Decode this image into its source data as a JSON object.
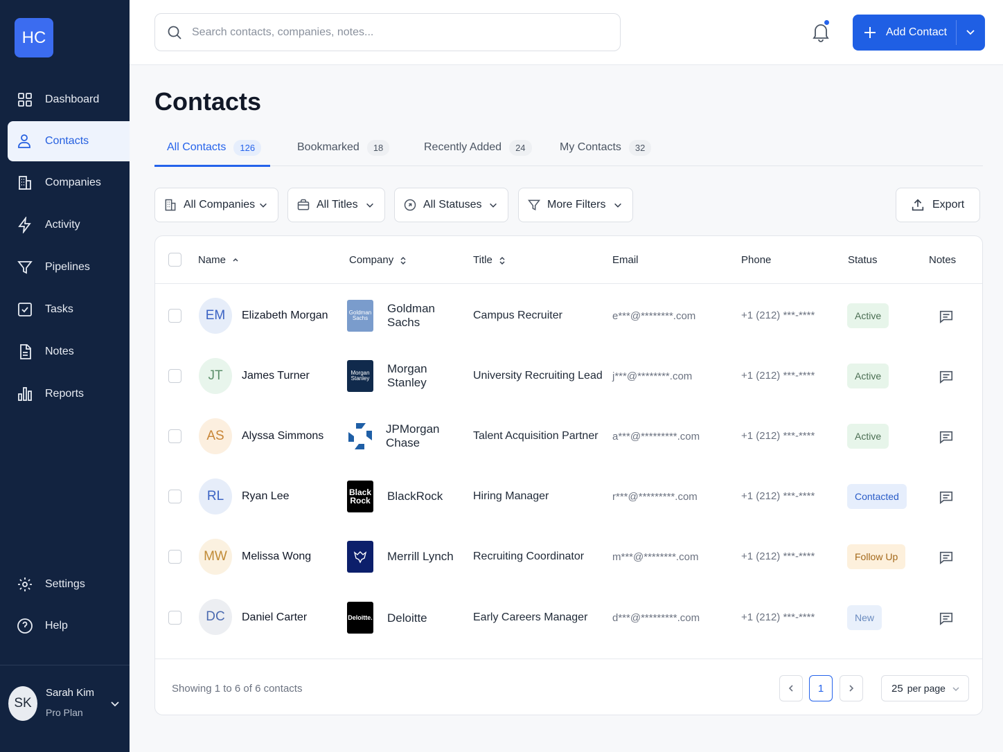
{
  "app": {
    "logo_text": "HC",
    "accent": "#2563eb",
    "sidebar_bg": "#122340"
  },
  "sidebar": {
    "items": [
      {
        "label": "Dashboard",
        "icon": "grid-icon"
      },
      {
        "label": "Contacts",
        "icon": "user-icon",
        "active": true
      },
      {
        "label": "Companies",
        "icon": "building-icon"
      },
      {
        "label": "Activity",
        "icon": "bolt-icon"
      },
      {
        "label": "Pipelines",
        "icon": "funnel-icon"
      },
      {
        "label": "Tasks",
        "icon": "checkbox-icon"
      },
      {
        "label": "Notes",
        "icon": "document-icon"
      },
      {
        "label": "Reports",
        "icon": "bar-chart-icon"
      }
    ],
    "bottom": [
      {
        "label": "Settings",
        "icon": "gear-icon"
      },
      {
        "label": "Help",
        "icon": "help-circle-icon"
      }
    ],
    "user": {
      "initials": "SK",
      "name": "Sarah Kim",
      "plan": "Pro Plan"
    }
  },
  "header": {
    "search_placeholder": "Search contacts, companies, notes...",
    "add_button": "Add Contact"
  },
  "page": {
    "title": "Contacts",
    "tabs": [
      {
        "label": "All Contacts",
        "count": "126",
        "active": true
      },
      {
        "label": "Bookmarked",
        "count": "18"
      },
      {
        "label": "Recently Added",
        "count": "24"
      },
      {
        "label": "My Contacts",
        "count": "32"
      }
    ],
    "filters": [
      {
        "label": "All Companies",
        "icon": "building-icon"
      },
      {
        "label": "All Titles",
        "icon": "briefcase-icon"
      },
      {
        "label": "All Statuses",
        "icon": "circle-status-icon"
      },
      {
        "label": "More Filters",
        "icon": "funnel-icon"
      }
    ],
    "export_label": "Export"
  },
  "table": {
    "columns": [
      "Name",
      "Company",
      "Title",
      "Email",
      "Phone",
      "Status",
      "Notes"
    ],
    "rows": [
      {
        "initials": "EM",
        "name": "Elizabeth Morgan",
        "company": "Goldman Sachs",
        "logo_text": "Goldman Sachs",
        "title": "Campus Recruiter",
        "email": "e***@********.com",
        "phone": "+1 (212) ***-****",
        "status": "Active"
      },
      {
        "initials": "JT",
        "name": "James Turner",
        "company": "Morgan Stanley",
        "logo_text": "Morgan Stanley",
        "title": "University Recruiting Lead",
        "email": "j***@********.com",
        "phone": "+1 (212) ***-****",
        "status": "Active"
      },
      {
        "initials": "AS",
        "name": "Alyssa Simmons",
        "company": "JPMorgan Chase",
        "logo_text": "",
        "title": "Talent Acquisition Partner",
        "email": "a***@*********.com",
        "phone": "+1 (212) ***-****",
        "status": "Active"
      },
      {
        "initials": "RL",
        "name": "Ryan Lee",
        "company": "BlackRock",
        "logo_text": "Black Rock",
        "title": "Hiring Manager",
        "email": "r***@*********.com",
        "phone": "+1 (212) ***-****",
        "status": "Contacted"
      },
      {
        "initials": "MW",
        "name": "Melissa Wong",
        "company": "Merrill Lynch",
        "logo_text": "",
        "title": "Recruiting Coordinator",
        "email": "m***@********.com",
        "phone": "+1 (212) ***-****",
        "status": "Follow Up"
      },
      {
        "initials": "DC",
        "name": "Daniel Carter",
        "company": "Deloitte",
        "logo_text": "Deloitte.",
        "title": "Early Careers Manager",
        "email": "d***@*********.com",
        "phone": "+1 (212) ***-****",
        "status": "New"
      }
    ]
  },
  "footer": {
    "showing": "Showing 1 to 6 of 6 contacts",
    "current_page": "1",
    "per_page_value": "25",
    "per_page_label": "per page"
  }
}
